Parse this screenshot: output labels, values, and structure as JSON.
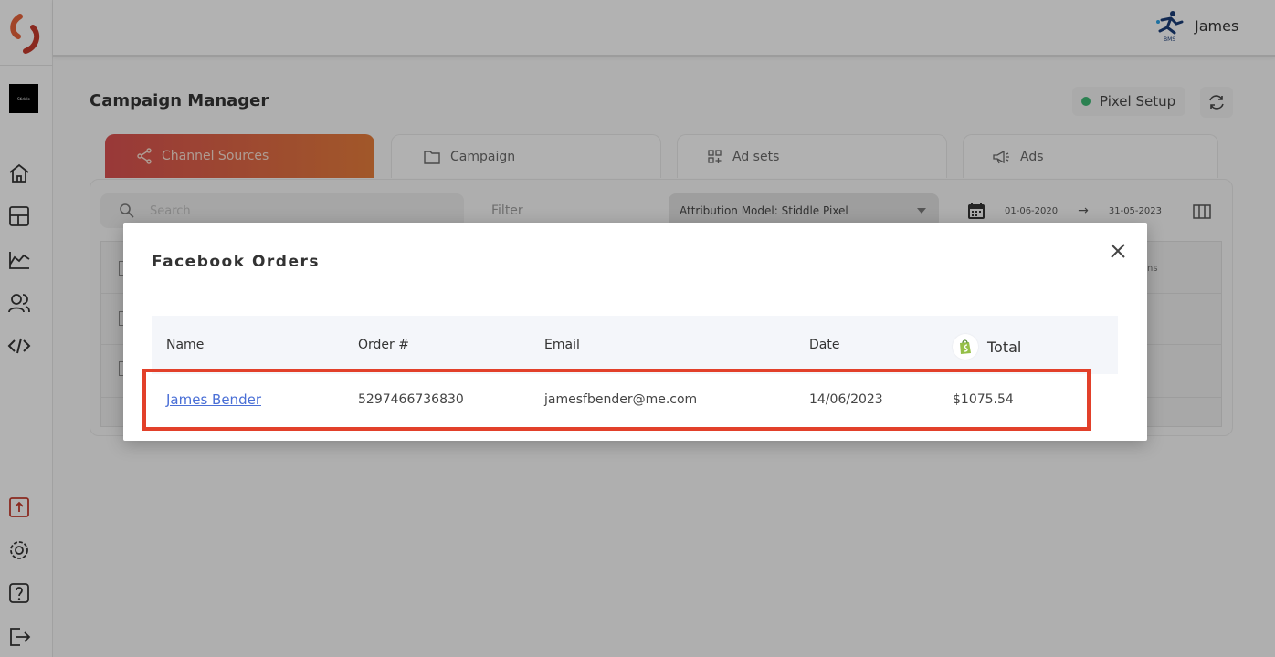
{
  "app": {
    "brand_text": "Stiddle",
    "user_name": "James",
    "bms_label": "BMS"
  },
  "page": {
    "title": "Campaign Manager",
    "pixel_setup_label": "Pixel Setup",
    "status_color": "#3cb371"
  },
  "tabs": [
    {
      "label": "Channel Sources",
      "icon": "share-icon",
      "active": true
    },
    {
      "label": "Campaign",
      "icon": "folder-icon",
      "active": false
    },
    {
      "label": "Ad sets",
      "icon": "grid-add-icon",
      "active": false
    },
    {
      "label": "Ads",
      "icon": "megaphone-icon",
      "active": false
    }
  ],
  "toolbar": {
    "search_placeholder": "Search",
    "filter_label": "Filter",
    "attribution_label": "Attribution Model: Stiddle Pixel",
    "date_from": "01-06-2020",
    "date_to": "31-05-2023",
    "arrow": "→",
    "background_col_fragment": "ns"
  },
  "modal": {
    "title": "Facebook Orders",
    "columns": [
      "Name",
      "Order #",
      "Email",
      "Date",
      "Total"
    ],
    "rows": [
      {
        "name": "James Bender",
        "order": "5297466736830",
        "email": "jamesfbender@me.com",
        "date": "14/06/2023",
        "total": "$1075.54"
      }
    ],
    "highlight_color": "#e2402a"
  }
}
